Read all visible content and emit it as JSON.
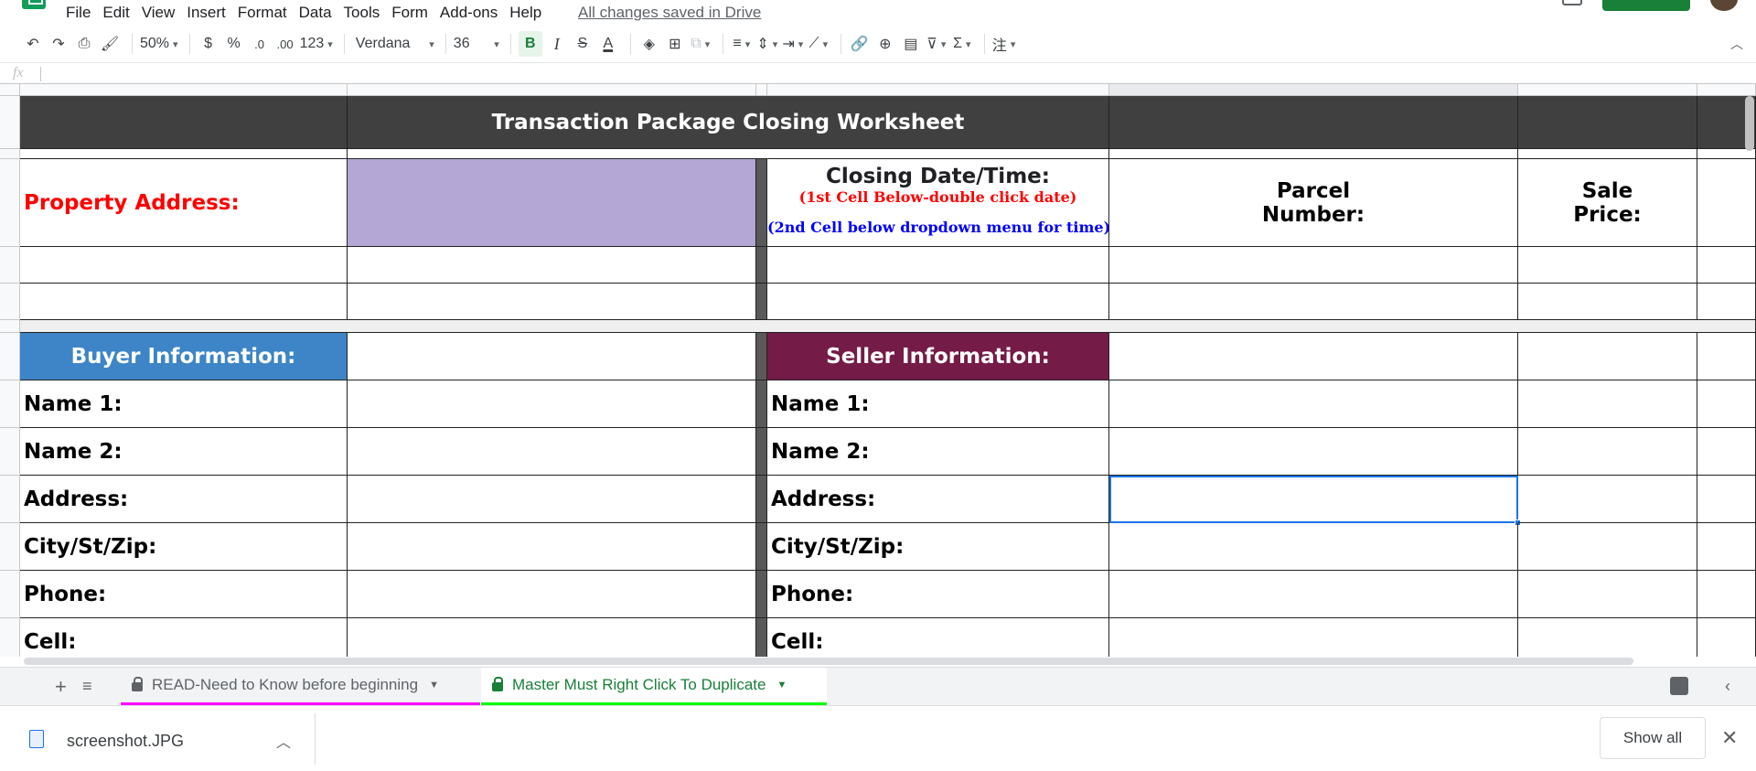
{
  "menu": {
    "items": [
      "File",
      "Edit",
      "View",
      "Insert",
      "Format",
      "Data",
      "Tools",
      "Form",
      "Add-ons",
      "Help"
    ],
    "save_status": "All changes saved in Drive"
  },
  "toolbar": {
    "zoom": "50%",
    "currency": "$",
    "percent": "%",
    "decrease_decimal": ".0",
    "increase_decimal": ".00",
    "more_formats": "123",
    "font": "Verdana",
    "font_size": "36",
    "bold": "B",
    "italic": "I",
    "strike": "S",
    "text_color": "A",
    "sum": "Σ"
  },
  "formula_bar": {
    "fx": "fx",
    "value": ""
  },
  "sheet": {
    "title": "Transaction Package Closing Worksheet",
    "property_address_label": "Property Address:",
    "closing_label": "Closing Date/Time:",
    "closing_hint1": "(1st Cell Below-double click date)",
    "closing_hint2": "(2nd Cell below dropdown menu for time)",
    "parcel_label_1": "Parcel",
    "parcel_label_2": "Number:",
    "sale_label_1": "Sale",
    "sale_label_2": "Price:",
    "buyer_header": "Buyer Information:",
    "seller_header": "Seller Information:",
    "buyer_fields": [
      "Name 1:",
      "Name 2:",
      "Address:",
      "City/St/Zip:",
      "Phone:",
      "Cell:"
    ],
    "seller_fields": [
      "Name 1:",
      "Name 2:",
      "Address:",
      "City/St/Zip:",
      "Phone:",
      "Cell:"
    ],
    "colors": {
      "title_bg": "#404040",
      "buyer_bg": "#3d85c6",
      "seller_bg": "#741b47",
      "address_input_bg": "#b4a7d6",
      "property_label_color": "#ff0000",
      "hint1_color": "#ff0000",
      "hint2_color": "#0000ff"
    }
  },
  "tabs": [
    {
      "label": "READ-Need to Know before beginning",
      "color": "#ff00ff",
      "active": false
    },
    {
      "label": "Master Must Right Click To Duplicate",
      "color": "#00ff00",
      "active": true
    }
  ],
  "downloads": {
    "file_name": "screenshot.JPG",
    "show_all": "Show all"
  }
}
